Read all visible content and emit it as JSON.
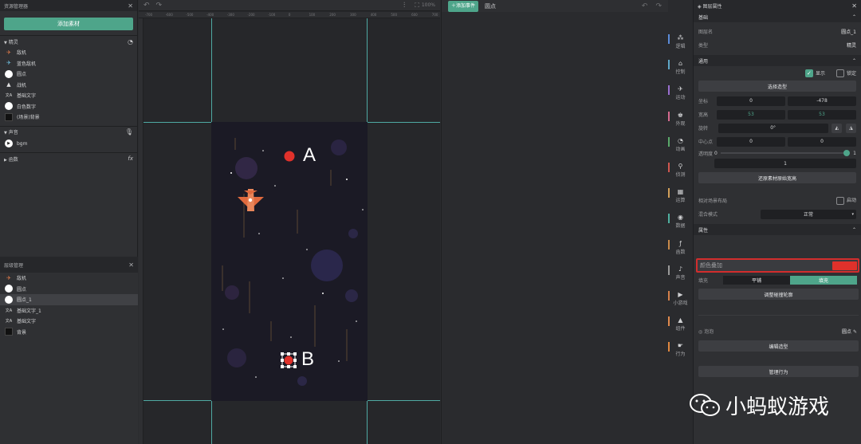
{
  "asset_panel": {
    "title": "资源管理器",
    "add_button": "添加素材",
    "sprites_header": "精灵",
    "sprites": [
      {
        "label": "敌机",
        "icon": "plane-icon"
      },
      {
        "label": "蓝色敌机",
        "icon": "plane-icon"
      },
      {
        "label": "圆点",
        "icon": "circle-icon"
      },
      {
        "label": "战机",
        "icon": "plane-icon"
      },
      {
        "label": "基础文字",
        "icon": "text-icon"
      },
      {
        "label": "白色数字",
        "icon": "circle-icon"
      },
      {
        "label": "(场景)背景",
        "icon": "scene-icon"
      }
    ],
    "sound_header": "声音",
    "sounds": [
      {
        "label": "bgm",
        "icon": "play-icon"
      }
    ],
    "functions_header": "函数",
    "fx_symbol": "fx"
  },
  "layer_panel": {
    "title": "层级管理",
    "items": [
      {
        "label": "敌机"
      },
      {
        "label": "圆点"
      },
      {
        "label": "圆点_1"
      },
      {
        "label": "基础文字_1"
      },
      {
        "label": "基础文字"
      },
      {
        "label": "背景"
      }
    ]
  },
  "editor": {
    "zoom": "100%",
    "ruler_ticks": [
      "-700",
      "-600",
      "-500",
      "-400",
      "-300",
      "-200",
      "-100",
      "0",
      "100",
      "200",
      "300",
      "400",
      "500",
      "600",
      "700"
    ],
    "label_a": "A",
    "label_b": "B"
  },
  "events": {
    "add_event": "添加事件",
    "object_name": "圆点"
  },
  "categories": [
    {
      "label": "逻辑",
      "glyph": "⁂",
      "color": "#5b8bd9"
    },
    {
      "label": "控制",
      "glyph": "⌂",
      "color": "#5fa8c9"
    },
    {
      "label": "运动",
      "glyph": "✈",
      "color": "#9a6fd0"
    },
    {
      "label": "外观",
      "glyph": "♚",
      "color": "#d66a8f"
    },
    {
      "label": "动画",
      "glyph": "◔",
      "color": "#5aa96a"
    },
    {
      "label": "侦测",
      "glyph": "⚲",
      "color": "#d0574f"
    },
    {
      "label": "运算",
      "glyph": "▦",
      "color": "#d3a05a"
    },
    {
      "label": "数据",
      "glyph": "◉",
      "color": "#4fb0a0"
    },
    {
      "label": "函数",
      "glyph": "ƒ",
      "color": "#c98a4a"
    },
    {
      "label": "声音",
      "glyph": "♪",
      "color": "#9a9a9a"
    },
    {
      "label": "小游戏",
      "glyph": "▶",
      "color": "#d6804a"
    },
    {
      "label": "组件",
      "glyph": "▲",
      "color": "#e08a4e"
    },
    {
      "label": "行为",
      "glyph": "☛",
      "color": "#e0873f"
    }
  ],
  "properties": {
    "title": "图层属性",
    "basic_header": "基础",
    "layer_name_label": "图层名",
    "layer_name_value": "圆点_1",
    "type_label": "类型",
    "type_value": "精灵",
    "general_header": "通用",
    "visible_label": "显示",
    "lock_label": "锁定",
    "select_shape": "选择造型",
    "coords_label": "坐标",
    "x": "0",
    "y": "-478",
    "size_label": "宽高",
    "width": "53",
    "height": "53",
    "rotation_label": "旋转",
    "rotation": "0°",
    "center_label": "中心点",
    "center_x": "0",
    "center_y": "0",
    "opacity_label": "透明度",
    "opacity_min": "0",
    "opacity_max": "1",
    "opacity_value": "1",
    "restore_size": "还原素材原始宽高",
    "relative_layout_label": "相对场景布局",
    "enable_label": "启动",
    "blend_label": "混合模式",
    "blend_value": "正常",
    "attr_header": "属性",
    "color_overlay_label": "颜色叠加",
    "color_overlay_value": "#e0312b",
    "fill_label": "填充",
    "fill_options": [
      "平铺",
      "填充"
    ],
    "adjust_collision": "调整碰撞轮廓",
    "bubble_label": "泡泡",
    "bubble_value": "圆点",
    "edit_shape": "编辑造型",
    "manage_behavior": "管理行为"
  },
  "watermark": "小蚂蚁游戏",
  "accent": "#4ea58a"
}
